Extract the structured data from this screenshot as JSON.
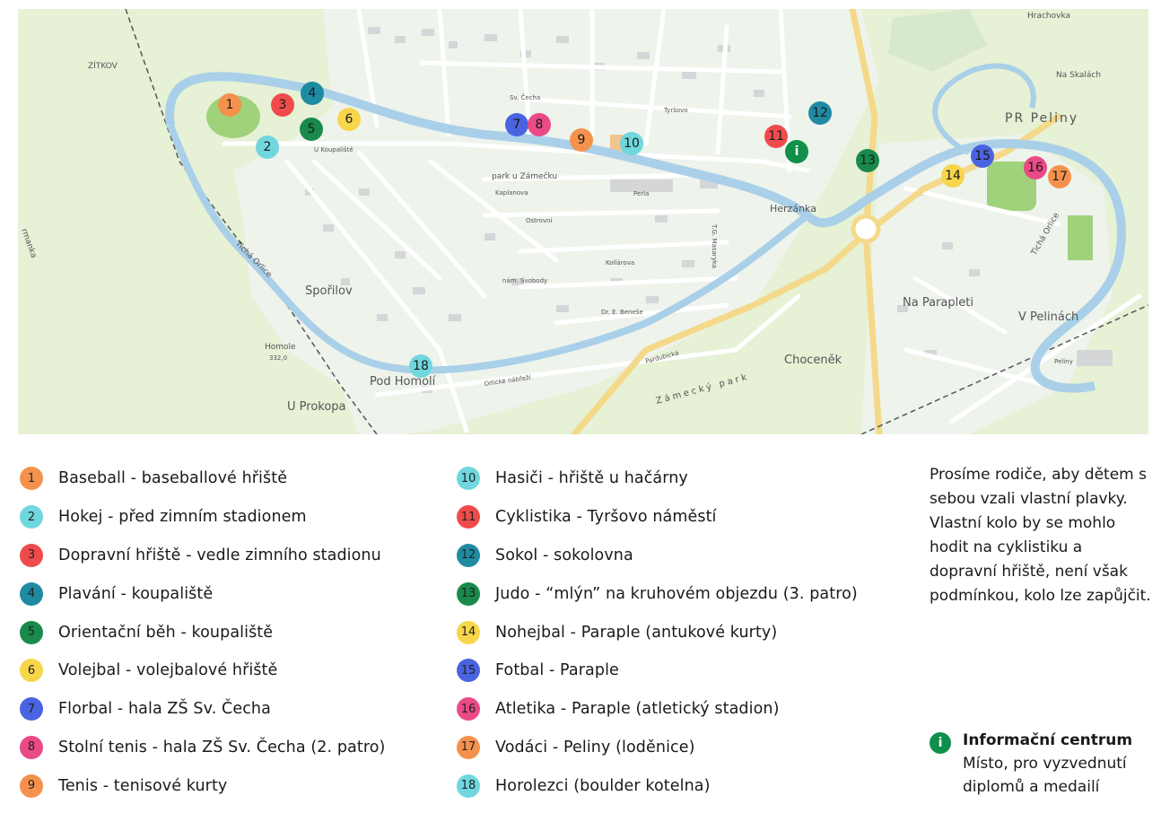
{
  "map": {
    "labels": {
      "zitkov": "ZÍTKOV",
      "park_zamecku": "park u Zámečku",
      "sporilov": "Spořilov",
      "homole": "Homole",
      "homole_elev": "332,0",
      "pod_homoli": "Pod Homolí",
      "u_prokopa": "U Prokopa",
      "herzanka": "Herzánka",
      "zamecky_park": "Zámecký park",
      "chocenek": "Choceněk",
      "na_parapleti": "Na Parapleti",
      "v_pelinach": "V Pelinách",
      "pr_peliny": "PR Peliny",
      "na_skalach": "Na Skalách",
      "ticha_orlice_1": "Tichá Orlice",
      "ticha_orlice_2": "Tichá Orlice",
      "hrachovka": "Hrachovka",
      "u_koupaliste": "U Koupaliště",
      "sv_cecha": "Sv. Čecha",
      "tyrsovo": "Tyršovo",
      "pardubicka": "Pardubická",
      "orlicke": "Orlické nábřeží",
      "nam_svobody": "nám. Svobody",
      "kollarova": "Kollárova",
      "ostrovni": "Ostrovní",
      "kaplanova": "Kaplanova",
      "perla": "Perla",
      "mayernova": "T.G. Masaryka",
      "peliny_street": "Peliny",
      "dr_benese": "Dr. E. Beneše",
      "manka": "rmanka"
    },
    "info_marker": "i",
    "markers": [
      "1",
      "2",
      "3",
      "4",
      "5",
      "6",
      "7",
      "8",
      "9",
      "10",
      "11",
      "12",
      "13",
      "14",
      "15",
      "16",
      "17",
      "18"
    ]
  },
  "legend": [
    {
      "num": "1",
      "text": "Baseball - baseballové hřiště",
      "color": "#f4924d"
    },
    {
      "num": "2",
      "text": "Hokej - před zimním stadionem",
      "color": "#6fd7dd"
    },
    {
      "num": "3",
      "text": "Dopravní hřiště - vedle zimního stadionu",
      "color": "#ef4b4b"
    },
    {
      "num": "4",
      "text": "Plavání - koupaliště",
      "color": "#1f8ba3"
    },
    {
      "num": "5",
      "text": "Orientační běh - koupaliště",
      "color": "#198a4c"
    },
    {
      "num": "6",
      "text": "Volejbal - volejbalové hřiště",
      "color": "#f7d64a"
    },
    {
      "num": "7",
      "text": "Florbal - hala ZŠ Sv. Čecha",
      "color": "#4a63e0"
    },
    {
      "num": "8",
      "text": "Stolní tenis - hala ZŠ Sv. Čecha (2. patro)",
      "color": "#ea4a86"
    },
    {
      "num": "9",
      "text": "Tenis - tenisové kurty",
      "color": "#f4924d"
    },
    {
      "num": "10",
      "text": "Hasiči - hřiště u hačárny",
      "color": "#6fd7dd"
    },
    {
      "num": "11",
      "text": "Cyklistika - Tyršovo náměstí",
      "color": "#ef4b4b"
    },
    {
      "num": "12",
      "text": "Sokol - sokolovna",
      "color": "#1f8ba3"
    },
    {
      "num": "13",
      "text": "Judo - “mlýn” na kruhovém objezdu (3. patro)",
      "color": "#198a4c"
    },
    {
      "num": "14",
      "text": "Nohejbal - Paraple (antukové kurty)",
      "color": "#f7d64a"
    },
    {
      "num": "15",
      "text": "Fotbal - Paraple",
      "color": "#4a63e0"
    },
    {
      "num": "16",
      "text": "Atletika - Paraple (atletický stadion)",
      "color": "#ea4a86"
    },
    {
      "num": "17",
      "text": "Vodáci - Peliny (loděnice)",
      "color": "#f4924d"
    },
    {
      "num": "18",
      "text": "Horolezci (boulder kotelna)",
      "color": "#6fd7dd"
    }
  ],
  "note": "Prosíme rodiče, aby dětem s sebou vzali vlastní plavky. Vlastní kolo by se mohlo hodit na cyklistiku a dopravní hřiště, není však podmínkou, kolo lze zapůjčit.",
  "info": {
    "badge": "i",
    "title": "Informační centrum",
    "desc": "Místo, pro vyzvednutí diplomů a medailí",
    "color": "#0f8f4a"
  }
}
